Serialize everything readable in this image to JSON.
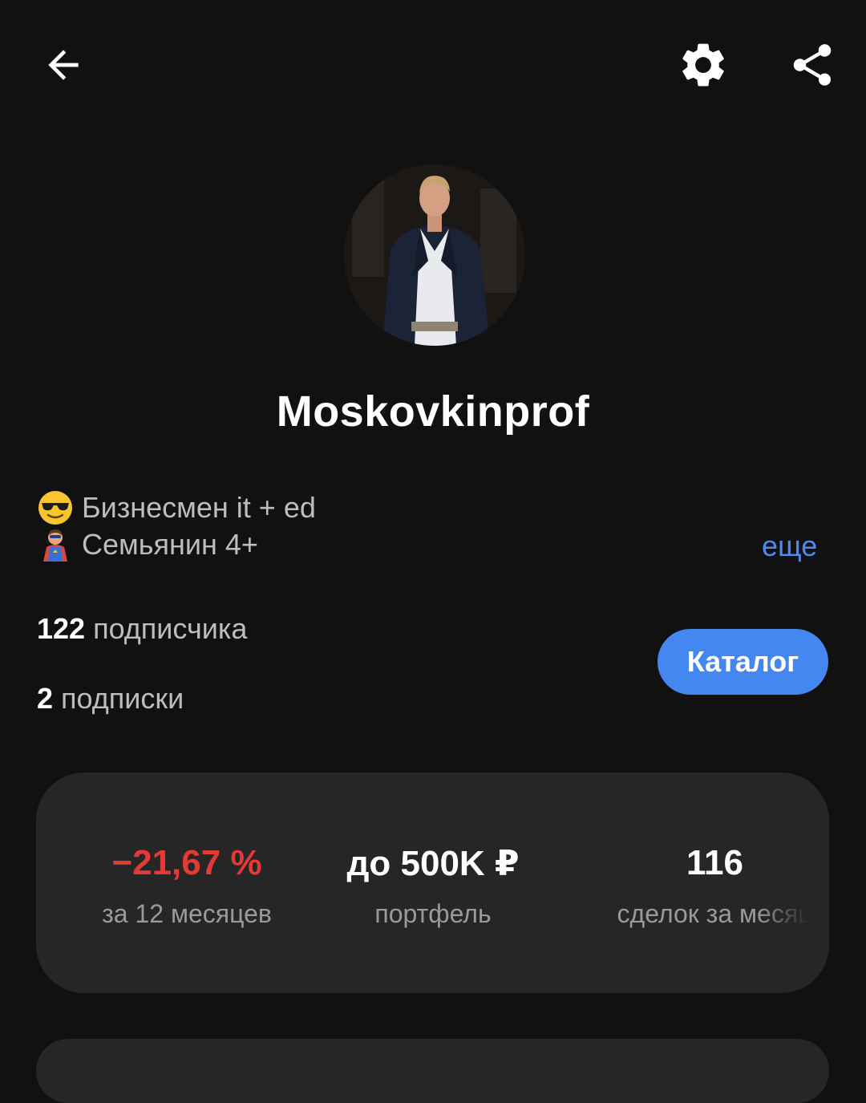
{
  "header": {
    "back_icon": "arrow-left-icon",
    "settings_icon": "gear-icon",
    "share_icon": "share-icon"
  },
  "profile": {
    "name": "Moskovkinprof",
    "bio": [
      {
        "emoji": "sunglasses-face",
        "text": "Бизнесмен it + ed"
      },
      {
        "emoji": "superhero",
        "text": "Семьянин 4+"
      }
    ],
    "more_label": "еще",
    "followers_count": "122",
    "followers_label": "подписчика",
    "following_count": "2",
    "following_label": "подписки",
    "catalog_label": "Каталог"
  },
  "stats": {
    "return_value": "−21,67 %",
    "return_label": "за 12 месяцев",
    "portfolio_value": "до 500K ₽",
    "portfolio_label": "портфель",
    "deals_value": "116",
    "deals_label": "сделок за месяц"
  },
  "colors": {
    "background": "#111111",
    "accent": "#4587f1",
    "link": "#4a8cf0",
    "negative": "#e53935",
    "card": "#262626"
  }
}
